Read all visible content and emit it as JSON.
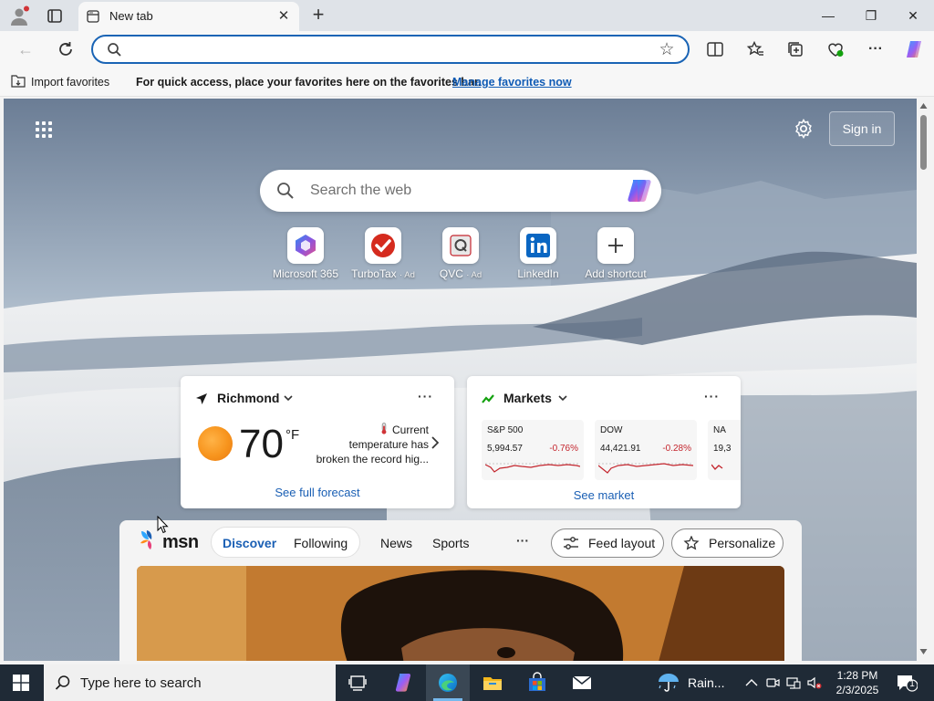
{
  "browser": {
    "tab": {
      "title": "New tab"
    },
    "address": {
      "value": "",
      "placeholder": ""
    }
  },
  "favorites_bar": {
    "import_label": "Import favorites",
    "message": "For quick access, place your favorites here on the favorites bar.",
    "manage_link": "Manage favorites now"
  },
  "newtab": {
    "sign_in": "Sign in",
    "search_placeholder": "Search the web",
    "shortcuts": [
      {
        "label": "Microsoft 365",
        "ad": "",
        "icon": "microsoft365-icon"
      },
      {
        "label": "TurboTax",
        "ad": "· Ad",
        "icon": "turbotax-icon"
      },
      {
        "label": "QVC",
        "ad": "· Ad",
        "icon": "qvc-icon"
      },
      {
        "label": "LinkedIn",
        "ad": "",
        "icon": "linkedin-icon"
      },
      {
        "label": "Add shortcut",
        "ad": "",
        "icon": "plus-icon"
      }
    ]
  },
  "weather": {
    "location": "Richmond",
    "temperature": "70",
    "unit": "°F",
    "alert_line1": "Current",
    "alert_line2": "temperature has",
    "alert_line3": "broken the record hig...",
    "forecast_link": "See full forecast",
    "more": "···"
  },
  "markets": {
    "title": "Markets",
    "more": "···",
    "tickers": [
      {
        "name": "S&P 500",
        "value": "5,994.57",
        "change": "-0.76%"
      },
      {
        "name": "DOW",
        "value": "44,421.91",
        "change": "-0.28%"
      },
      {
        "name": "NA",
        "value": "19,3",
        "change": ""
      }
    ],
    "see_market": "See market"
  },
  "feed": {
    "brand": "msn",
    "tabs": {
      "discover": "Discover",
      "following": "Following"
    },
    "nav": [
      "News",
      "Sports"
    ],
    "more": "···",
    "feed_layout": "Feed layout",
    "personalize": "Personalize"
  },
  "taskbar": {
    "search_placeholder": "Type here to search",
    "weather_text": "Rain...",
    "time": "1:28 PM",
    "date": "2/3/2025",
    "notification_count": "1"
  },
  "colors": {
    "accent": "#1a64b5",
    "link": "#0f5bb5",
    "negative": "#c4262e",
    "taskbar": "#1f2a36"
  }
}
